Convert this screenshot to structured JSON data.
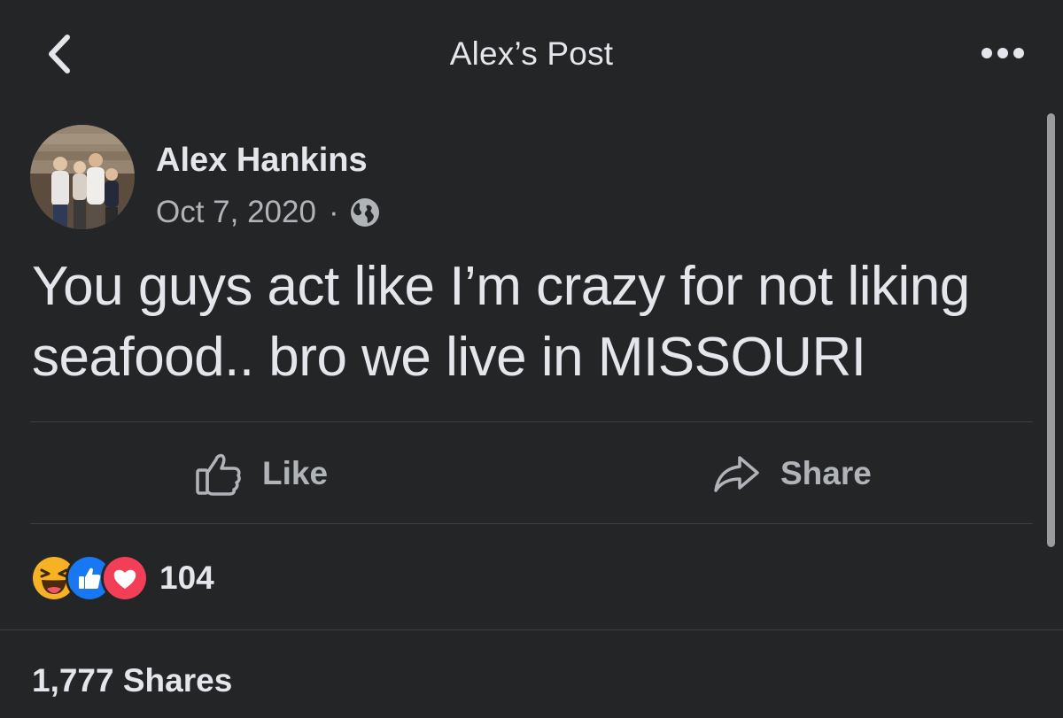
{
  "header": {
    "title": "Alex’s Post",
    "back_icon": "chevron-left-icon",
    "more_icon": "more-dots-icon"
  },
  "post": {
    "author_name": "Alex Hankins",
    "date": "Oct 7, 2020",
    "separator": "·",
    "privacy_icon": "globe-icon",
    "text_lines": [
      "You guys act like I’m crazy for not liking",
      "seafood.. bro we live in MISSOURI"
    ]
  },
  "actions": {
    "like_label": "Like",
    "share_label": "Share"
  },
  "engagement": {
    "reaction_icons": [
      "haha-icon",
      "like-reaction-icon",
      "love-reaction-icon"
    ],
    "reaction_count": "104",
    "shares_text": "1,777 Shares"
  },
  "colors": {
    "background": "#242526",
    "primary_text": "#e4e6eb",
    "secondary_text": "#b0b3b8",
    "divider": "#3e4042",
    "like_blue": "#1877f2",
    "love_red": "#f33e58",
    "haha_yellow": "#f7b125"
  }
}
